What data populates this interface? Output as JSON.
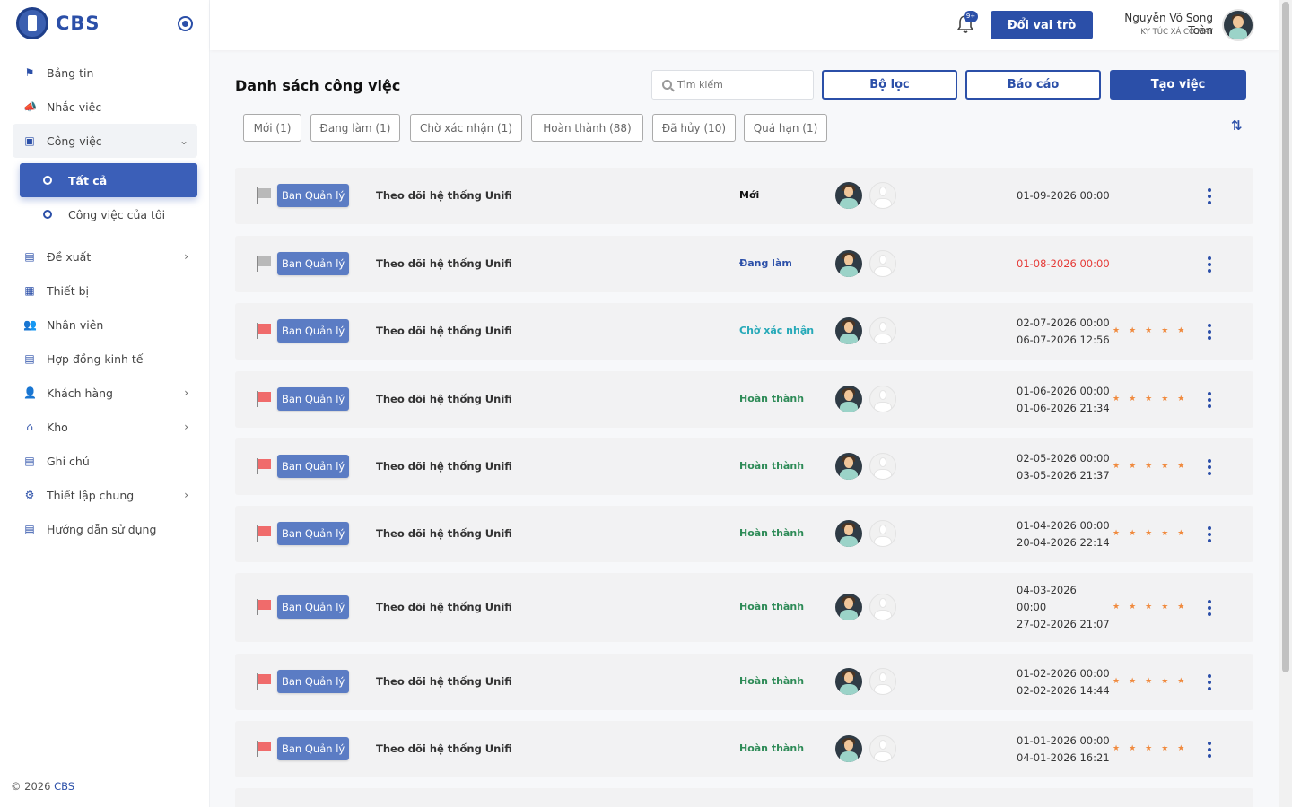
{
  "brand": {
    "name": "CBS"
  },
  "sidebar": {
    "items": [
      {
        "label": "Bảng tin",
        "icon": "flag-icon",
        "glyph": "⚑",
        "has_children": false
      },
      {
        "label": "Nhắc việc",
        "icon": "megaphone-icon",
        "glyph": "📣",
        "has_children": false
      },
      {
        "label": "Công việc",
        "icon": "briefcase-icon",
        "glyph": "▣",
        "has_children": true,
        "expanded": true,
        "children": [
          {
            "label": "Tất cả",
            "active": true
          },
          {
            "label": "Công việc của tôi",
            "active": false
          }
        ]
      },
      {
        "label": "Đề xuất",
        "icon": "document-icon",
        "glyph": "▤",
        "has_children": true
      },
      {
        "label": "Thiết bị",
        "icon": "devices-icon",
        "glyph": "▦",
        "has_children": false
      },
      {
        "label": "Nhân viên",
        "icon": "users-icon",
        "glyph": "👥",
        "has_children": false
      },
      {
        "label": "Hợp đồng kinh tế",
        "icon": "contract-icon",
        "glyph": "▤",
        "has_children": false
      },
      {
        "label": "Khách hàng",
        "icon": "customer-icon",
        "glyph": "👤",
        "has_children": true
      },
      {
        "label": "Kho",
        "icon": "warehouse-icon",
        "glyph": "⌂",
        "has_children": true
      },
      {
        "label": "Ghi chú",
        "icon": "note-icon",
        "glyph": "▤",
        "has_children": false
      },
      {
        "label": "Thiết lập chung",
        "icon": "gear-icon",
        "glyph": "⚙",
        "has_children": true
      },
      {
        "label": "Hướng dẫn sử dụng",
        "icon": "guide-icon",
        "glyph": "▤",
        "has_children": false
      }
    ],
    "copyright_prefix": "© 2026 ",
    "copyright_brand": "CBS"
  },
  "header": {
    "notification_badge": "9+",
    "switch_role_label": "Đổi vai trò",
    "user_name": "Nguyễn Võ Song Toàn",
    "user_org": "KÝ TÚC XÁ CỎ MAY"
  },
  "main": {
    "title": "Danh sách công việc",
    "search_placeholder": "Tìm kiếm",
    "filter_label": "Bộ lọc",
    "report_label": "Báo cáo",
    "create_label": "Tạo việc",
    "status_tabs": [
      {
        "label": "Mới (1)"
      },
      {
        "label": "Đang làm (1)"
      },
      {
        "label": "Chờ xác nhận (1)"
      },
      {
        "label": "Hoàn thành (88)"
      },
      {
        "label": "Đã hủy (10)"
      },
      {
        "label": "Quá hạn (1)"
      }
    ],
    "colors": {
      "primary": "#2b4fa8",
      "flag_red": "#f06b6b",
      "flag_grey": "#b9b9b9",
      "overdue": "#e53935",
      "pending": "#26a9b8",
      "done": "#2e8b57",
      "in_progress": "#2b4fa8",
      "new": "#111111",
      "star": "#f08a3e"
    },
    "tasks": [
      {
        "tag": "Ban Quản lý",
        "title": "Theo dõi hệ thống Unifi",
        "status": "Mới",
        "status_color": "#111111",
        "flag": "grey",
        "dates": [
          "01-09-2026 00:00"
        ],
        "date_color": "#333333",
        "stars": ""
      },
      {
        "tag": "Ban Quản lý",
        "title": "Theo dõi hệ thống Unifi",
        "status": "Đang làm",
        "status_color": "#2b4fa8",
        "flag": "grey",
        "dates": [
          "01-08-2026 00:00"
        ],
        "date_color": "#e53935",
        "stars": ""
      },
      {
        "tag": "Ban Quản lý",
        "title": "Theo dõi hệ thống Unifi",
        "status": "Chờ xác nhận",
        "status_color": "#26a9b8",
        "flag": "red",
        "dates": [
          "02-07-2026 00:00",
          "06-07-2026 12:56"
        ],
        "date_color": "#333333",
        "stars": "★★★★★"
      },
      {
        "tag": "Ban Quản lý",
        "title": "Theo dõi hệ thống Unifi",
        "status": "Hoàn thành",
        "status_color": "#2e8b57",
        "flag": "red",
        "dates": [
          "01-06-2026 00:00",
          "01-06-2026 21:34"
        ],
        "date_color": "#333333",
        "stars": "★★★★★"
      },
      {
        "tag": "Ban Quản lý",
        "title": "Theo dõi hệ thống Unifi",
        "status": "Hoàn thành",
        "status_color": "#2e8b57",
        "flag": "red",
        "dates": [
          "02-05-2026 00:00",
          "03-05-2026 21:37"
        ],
        "date_color": "#333333",
        "stars": "★★★★★"
      },
      {
        "tag": "Ban Quản lý",
        "title": "Theo dõi hệ thống Unifi",
        "status": "Hoàn thành",
        "status_color": "#2e8b57",
        "flag": "red",
        "dates": [
          "01-04-2026 00:00",
          "20-04-2026 22:14"
        ],
        "date_color": "#333333",
        "stars": "★★★★★"
      },
      {
        "tag": "Ban Quản lý",
        "title": "Theo dõi hệ thống Unifi",
        "status": "Hoàn thành",
        "status_color": "#2e8b57",
        "flag": "red",
        "dates": [
          "04-03-2026",
          "00:00",
          "27-02-2026 21:07"
        ],
        "date_color": "#333333",
        "stars": "★★★★★"
      },
      {
        "tag": "Ban Quản lý",
        "title": "Theo dõi hệ thống Unifi",
        "status": "Hoàn thành",
        "status_color": "#2e8b57",
        "flag": "red",
        "dates": [
          "01-02-2026 00:00",
          "02-02-2026 14:44"
        ],
        "date_color": "#333333",
        "stars": "★★★★★"
      },
      {
        "tag": "Ban Quản lý",
        "title": "Theo dõi hệ thống Unifi",
        "status": "Hoàn thành",
        "status_color": "#2e8b57",
        "flag": "red",
        "dates": [
          "01-01-2026 00:00",
          "04-01-2026 16:21"
        ],
        "date_color": "#333333",
        "stars": "★★★★★"
      }
    ]
  }
}
